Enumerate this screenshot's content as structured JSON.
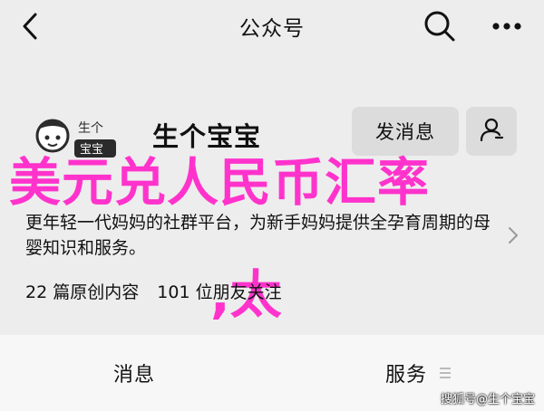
{
  "navbar": {
    "title": "公众号",
    "back_icon": "back-arrow-icon",
    "search_icon": "search-icon",
    "more_icon": "more-icon"
  },
  "profile": {
    "avatar_text_top": "生个",
    "avatar_text_bottom": "宝宝",
    "name": "生个宝宝",
    "message_button": "发消息",
    "user_button_icon": "user-icon",
    "description": "更年轻一代妈妈的社群平台，为新手妈妈提供全孕育周期的母婴知识和服务。",
    "chevron_icon": "chevron-right-icon",
    "stats": {
      "articles": "22 篇原创内容",
      "followers": "101 位朋友关注"
    }
  },
  "overlay": {
    "line1": "美元兑人民币汇率",
    "line2": ",太",
    "color": "#ff33cc"
  },
  "tabbar": {
    "messages": "消息",
    "services": "服务",
    "services_icon": "menu-icon"
  },
  "watermark": "搜狐号@生个宝宝"
}
